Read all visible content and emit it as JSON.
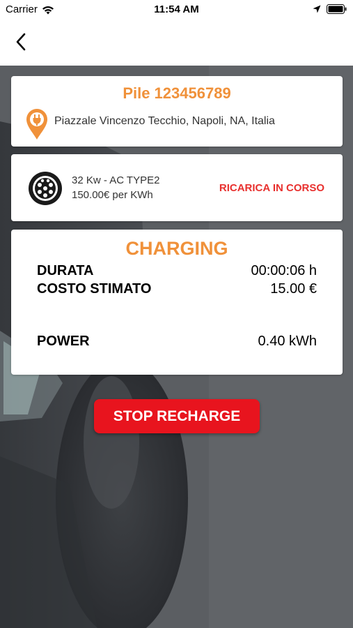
{
  "status_bar": {
    "carrier": "Carrier",
    "time": "11:54 AM"
  },
  "nav": {
    "back_icon": "chevron-left-icon"
  },
  "station": {
    "title": "Pile 123456789",
    "address": "Piazzale Vincenzo Tecchio, Napoli, NA, Italia",
    "pin_icon": "charging-pin-icon"
  },
  "connector": {
    "type": "32 Kw - AC TYPE2",
    "price": "150.00€ per KWh",
    "status": "RICARICA IN CORSO",
    "icon": "type2-connector-icon"
  },
  "session": {
    "title": "CHARGING",
    "rows": [
      {
        "label": "DURATA",
        "value": "00:00:06 h"
      },
      {
        "label": "COSTO STIMATO",
        "value": "15.00 €"
      },
      {
        "label": "POWER",
        "value": "0.40 kWh"
      }
    ]
  },
  "actions": {
    "stop_label": "STOP RECHARGE"
  },
  "colors": {
    "accent_orange": "#f0913a",
    "status_red": "#e8302e",
    "button_red": "#e8141e"
  }
}
